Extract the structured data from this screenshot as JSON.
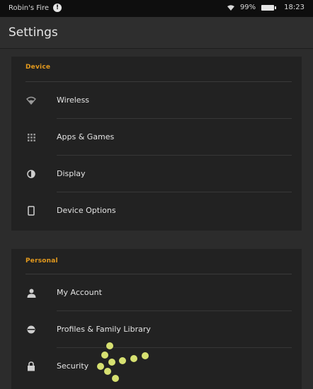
{
  "status_bar": {
    "device_name": "Robin's Fire",
    "notification_icon": "info",
    "battery_percent": "99%",
    "time": "18:23"
  },
  "header": {
    "title": "Settings"
  },
  "sections": {
    "device": {
      "label": "Device",
      "items": [
        {
          "label": "Wireless",
          "icon": "wifi-icon"
        },
        {
          "label": "Apps & Games",
          "icon": "apps-grid-icon"
        },
        {
          "label": "Display",
          "icon": "contrast-icon"
        },
        {
          "label": "Device Options",
          "icon": "tablet-icon"
        }
      ]
    },
    "personal": {
      "label": "Personal",
      "items": [
        {
          "label": "My Account",
          "icon": "person-icon"
        },
        {
          "label": "Profiles & Family Library",
          "icon": "profile-icon"
        },
        {
          "label": "Security",
          "icon": "lock-icon"
        }
      ]
    }
  },
  "colors": {
    "section_header": "#e49a1d",
    "background": "#2c2c2c",
    "card": "#222222",
    "text": "#e4e4e4",
    "touch_indicator": "#d6e071"
  }
}
